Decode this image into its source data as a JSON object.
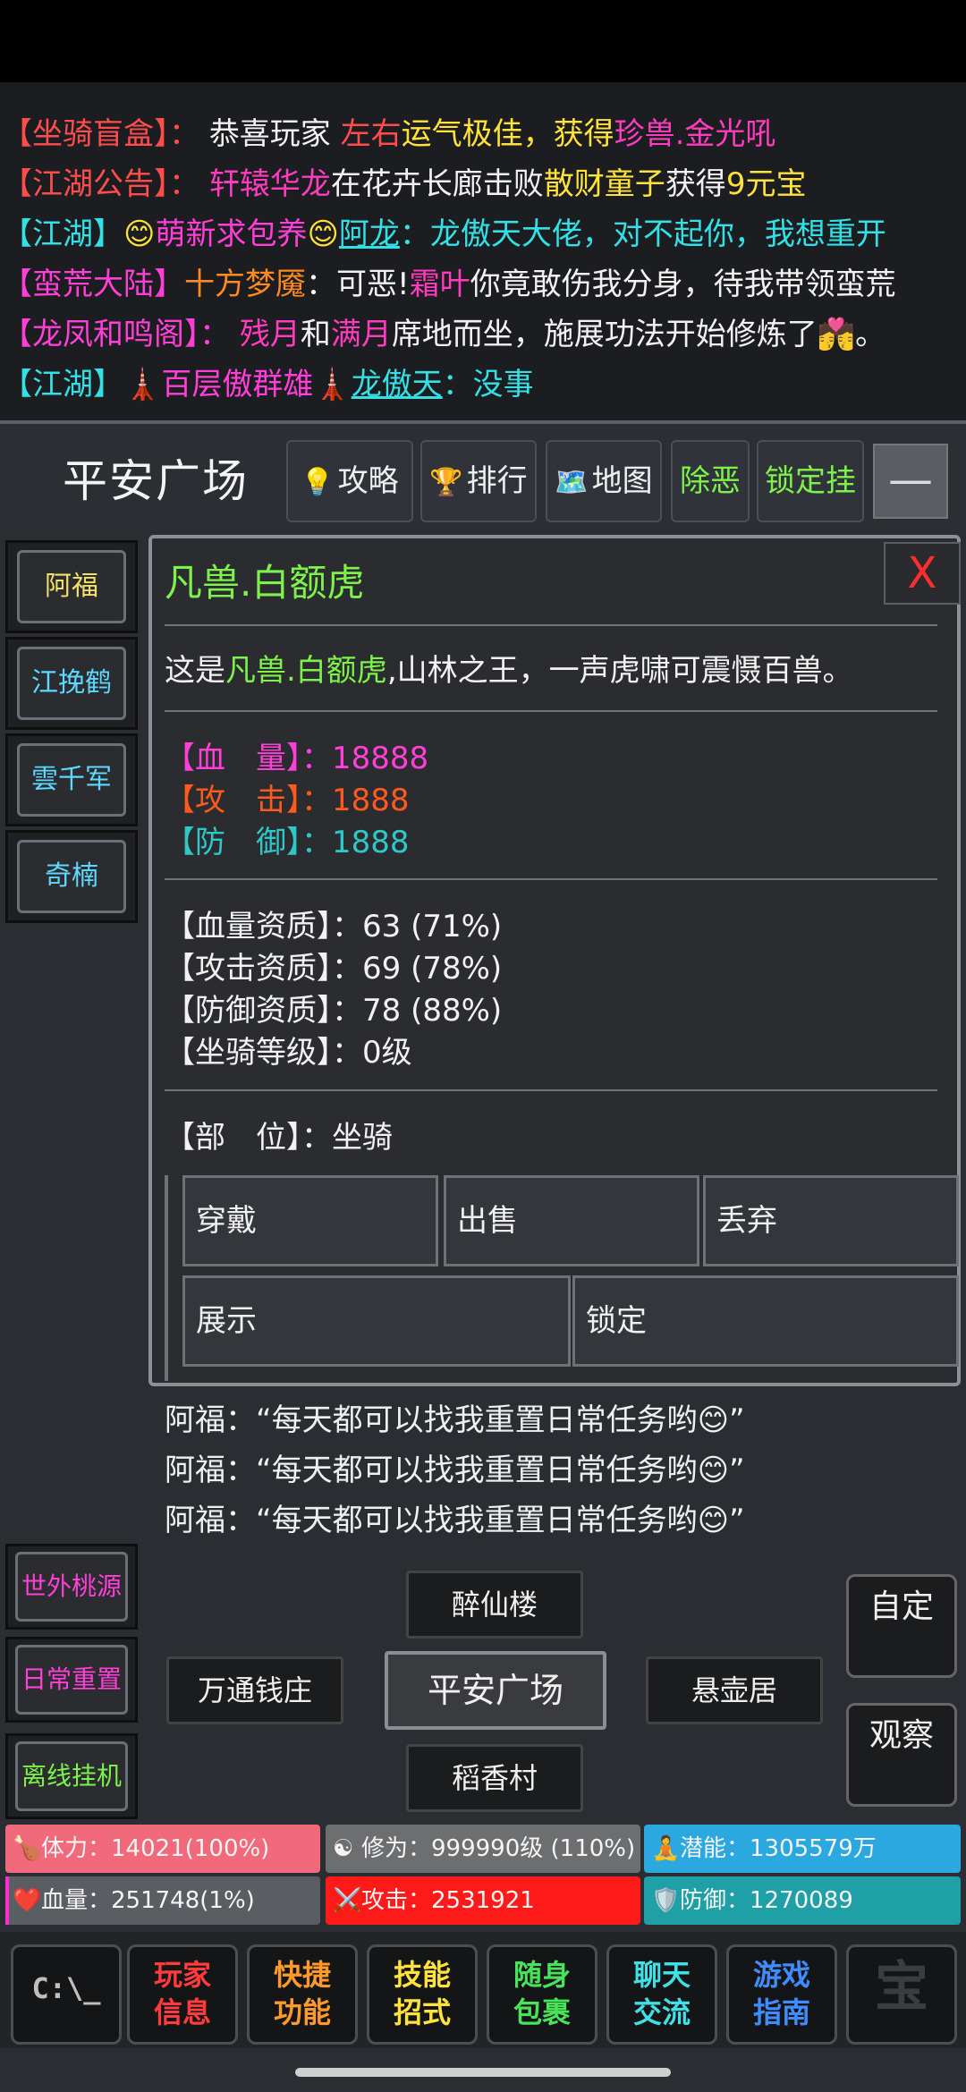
{
  "chat": [
    {
      "parts": [
        {
          "t": "【坐骑盲盒】",
          "c": "c-red"
        },
        {
          "t": "： ",
          "c": "c-red"
        },
        {
          "t": "恭喜玩家 ",
          "c": "c-white"
        },
        {
          "t": "左右",
          "c": "c-red"
        },
        {
          "t": "运气极佳，获得",
          "c": "c-yellow"
        },
        {
          "t": "珍兽.金光吼",
          "c": "c-magenta"
        }
      ]
    },
    {
      "parts": [
        {
          "t": "【江湖公告】",
          "c": "c-red"
        },
        {
          "t": "： ",
          "c": "c-red"
        },
        {
          "t": "轩辕华龙",
          "c": "c-magenta"
        },
        {
          "t": "在花卉长廊击败",
          "c": "c-white"
        },
        {
          "t": "散财童子",
          "c": "c-yellow"
        },
        {
          "t": "获得",
          "c": "c-white"
        },
        {
          "t": "9元宝",
          "c": "c-yellow"
        }
      ]
    },
    {
      "parts": [
        {
          "t": "【江湖】",
          "c": "c-cyan"
        },
        {
          "t": "😊",
          "c": "c-yellow"
        },
        {
          "t": "萌新求包养",
          "c": "c-pink"
        },
        {
          "t": "😊",
          "c": "c-yellow"
        },
        {
          "t": "阿龙",
          "c": "c-cyan u"
        },
        {
          "t": "：龙傲天大佬，对不起你，我想重开",
          "c": "c-cyan"
        }
      ]
    },
    {
      "parts": [
        {
          "t": "【蛮荒大陆】",
          "c": "c-pink"
        },
        {
          "t": "十方梦魇",
          "c": "c-orange"
        },
        {
          "t": "：可恶!",
          "c": "c-white"
        },
        {
          "t": "霜叶",
          "c": "c-magenta"
        },
        {
          "t": "你竟敢伤我分身，待我带领蛮荒",
          "c": "c-white"
        }
      ]
    },
    {
      "parts": [
        {
          "t": "【龙凤和鸣阁】",
          "c": "c-pink"
        },
        {
          "t": "： ",
          "c": "c-pink"
        },
        {
          "t": "残月",
          "c": "c-magenta"
        },
        {
          "t": "和",
          "c": "c-white"
        },
        {
          "t": "满月",
          "c": "c-magenta"
        },
        {
          "t": "席地而坐，施展功法开始修炼了💏。",
          "c": "c-white"
        }
      ]
    },
    {
      "parts": [
        {
          "t": "【江湖】",
          "c": "c-cyan"
        },
        {
          "t": "🗼",
          "c": "c-orange"
        },
        {
          "t": "百层傲群雄",
          "c": "c-pink"
        },
        {
          "t": "🗼",
          "c": "c-orange"
        },
        {
          "t": "龙傲天",
          "c": "c-cyan u"
        },
        {
          "t": "：没事",
          "c": "c-cyan"
        }
      ]
    }
  ],
  "location": {
    "title": "平安广场",
    "tabs": [
      {
        "icon": "💡",
        "label": "攻略"
      },
      {
        "icon": "🏆",
        "label": "排行"
      },
      {
        "icon": "🗺️",
        "label": "地图"
      },
      {
        "icon": "",
        "label": "除恶"
      },
      {
        "icon": "",
        "label": "锁定挂"
      }
    ],
    "collapse": "—"
  },
  "npcs": [
    "阿福",
    "江挽鹤",
    "雲千军",
    "奇楠"
  ],
  "item": {
    "name": "凡兽.白额虎",
    "close": "X",
    "desc_prefix": "这是",
    "desc_name": "凡兽.白额虎",
    "desc_suffix": ",山林之王，一声虎啸可震慑百兽。",
    "hp_label": "【血　量】：",
    "hp": "18888",
    "atk_label": "【攻　击】：",
    "atk": "1888",
    "def_label": "【防　御】：",
    "def": "1888",
    "q1": "【血量资质】：63 (71%)",
    "q2": "【攻击资质】：69 (78%)",
    "q3": "【防御资质】：78 (88%)",
    "q4": "【坐骑等级】：0级",
    "slot": "【部　位】：坐骑",
    "actions": [
      "穿戴",
      "出售",
      "丢弃",
      "展示",
      "锁定"
    ]
  },
  "npc_talk": [
    "阿福：“每天都可以找我重置日常任务哟😊”",
    "阿福：“每天都可以找我重置日常任务哟😊”",
    "阿福：“每天都可以找我重置日常任务哟😊”"
  ],
  "side_buttons": [
    "世外桃源",
    "日常重置",
    "离线挂机"
  ],
  "map": {
    "north": "醉仙楼",
    "west": "万通钱庄",
    "center": "平安广场",
    "east": "悬壶居",
    "south": "稻香村",
    "right_top": "自定",
    "right_bottom": "观察"
  },
  "stats": {
    "stamina": "体力：14021(100%)",
    "cultivation": "修为：999990级 (110%)",
    "potential": "潜能：1305579万",
    "hp": "血量：251748(1%)",
    "attack": "攻击：2531921",
    "defense": "防御：1270089"
  },
  "nav": [
    {
      "l1": "玩家",
      "l2": "信息",
      "color": "#ff3b3b"
    },
    {
      "l1": "快捷",
      "l2": "功能",
      "color": "#ff9a2a"
    },
    {
      "l1": "技能",
      "l2": "招式",
      "color": "#ffe23a"
    },
    {
      "l1": "随身",
      "l2": "包裹",
      "color": "#49e35a"
    },
    {
      "l1": "聊天",
      "l2": "交流",
      "color": "#3fe0e6"
    },
    {
      "l1": "游戏",
      "l2": "指南",
      "color": "#3f8cff"
    }
  ],
  "nav_left_icon": "C:\\_",
  "nav_right_icon": "宝"
}
